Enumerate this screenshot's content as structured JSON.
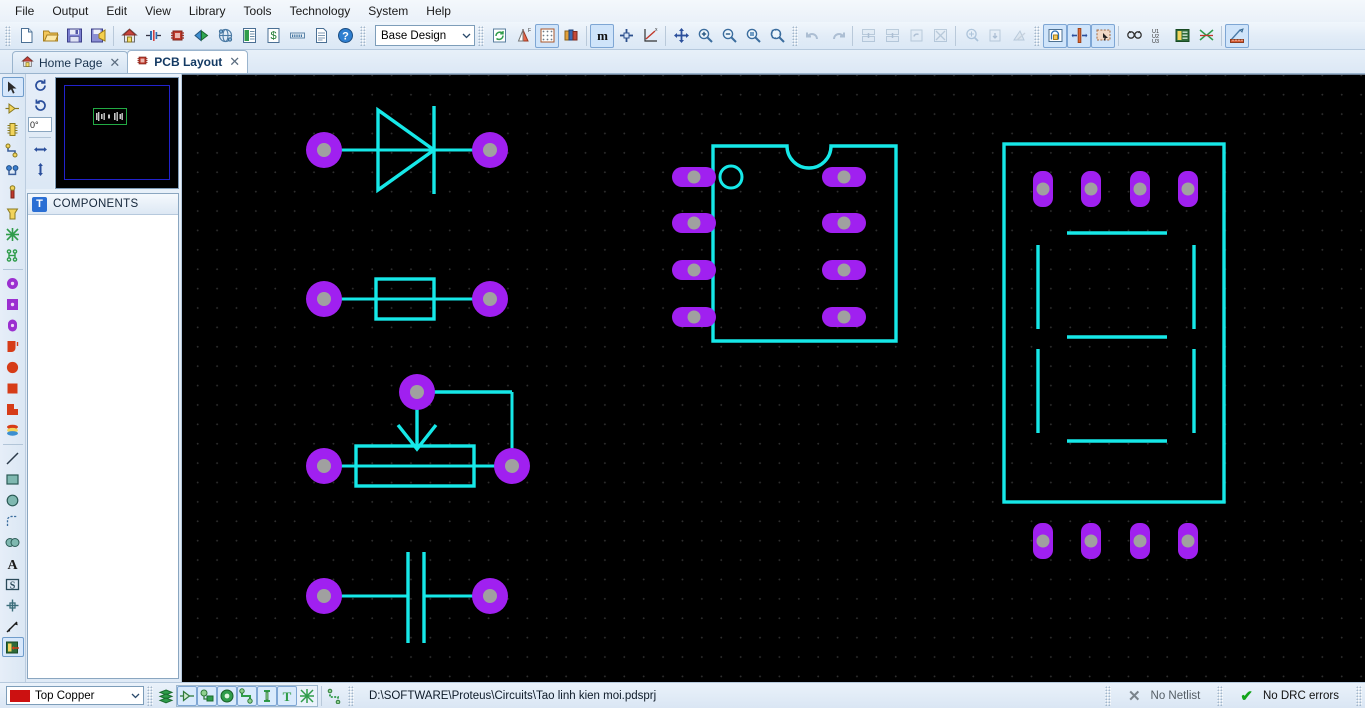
{
  "app": {
    "title": "Proteus PCB Layout"
  },
  "menu": {
    "items": [
      {
        "label": "File"
      },
      {
        "label": "Output"
      },
      {
        "label": "Edit"
      },
      {
        "label": "View"
      },
      {
        "label": "Library"
      },
      {
        "label": "Tools"
      },
      {
        "label": "Technology"
      },
      {
        "label": "System"
      },
      {
        "label": "Help"
      }
    ]
  },
  "toolbar": {
    "file_group": [
      {
        "name": "new-design-icon",
        "title": "New Design"
      },
      {
        "name": "open-design-icon",
        "title": "Open Design"
      },
      {
        "name": "save-design-icon",
        "title": "Save Design"
      },
      {
        "name": "import-export-icon",
        "title": "Import/Export"
      }
    ],
    "nav_group": [
      {
        "name": "home-page-icon",
        "title": "Home Page"
      },
      {
        "name": "schematic-capture-icon",
        "title": "Schematic Capture"
      },
      {
        "name": "pcb-layout-icon",
        "title": "PCB Layout"
      },
      {
        "name": "3d-visualizer-icon",
        "title": "3D Visualizer"
      },
      {
        "name": "design-explorer-icon",
        "title": "Design Explorer"
      },
      {
        "name": "bill-of-materials-icon",
        "title": "Bill of Materials"
      },
      {
        "name": "bom-cost-icon",
        "title": "BOM Cost"
      },
      {
        "name": "gerber-viewer-icon",
        "title": "Gerber Viewer"
      },
      {
        "name": "report-icon",
        "title": "Report"
      },
      {
        "name": "help-icon",
        "title": "Help"
      }
    ],
    "technology_value": "Base Design",
    "view_group": [
      {
        "name": "redraw-icon",
        "title": "Redraw Display"
      },
      {
        "name": "layers-icon",
        "title": "Display Layers"
      },
      {
        "name": "grid-icon",
        "title": "Toggle Grid"
      },
      {
        "name": "layer-colors-icon",
        "title": "Layer Colours"
      }
    ],
    "metric_group": [
      {
        "name": "metric-icon",
        "title": "Toggle Metric/Imperial"
      },
      {
        "name": "origin-icon",
        "title": "Set Origin"
      },
      {
        "name": "axes-icon",
        "title": "Display Origin"
      }
    ],
    "zoom_group": [
      {
        "name": "pan-icon",
        "title": "Pan"
      },
      {
        "name": "zoom-in-icon",
        "title": "Zoom In"
      },
      {
        "name": "zoom-out-icon",
        "title": "Zoom Out"
      },
      {
        "name": "zoom-all-icon",
        "title": "Zoom To View Entire Board"
      },
      {
        "name": "zoom-area-icon",
        "title": "Zoom To Area"
      }
    ],
    "edit_group": [
      {
        "name": "undo-icon",
        "title": "Undo"
      },
      {
        "name": "redo-icon",
        "title": "Redo"
      },
      {
        "name": "cut-icon",
        "title": "Cut To Clipboard"
      },
      {
        "name": "copy-icon",
        "title": "Copy To Clipboard"
      },
      {
        "name": "paste-icon",
        "title": "Paste From Clipboard"
      },
      {
        "name": "delete-icon",
        "title": "Delete Selected Objects"
      },
      {
        "name": "copy-blocks-icon",
        "title": "Copy Blocks"
      },
      {
        "name": "move-blocks-icon",
        "title": "Move Blocks"
      },
      {
        "name": "rotate-blocks-icon",
        "title": "Rotate Blocks"
      }
    ],
    "route_group": [
      {
        "name": "auto-router-icon",
        "title": "Auto Router"
      },
      {
        "name": "track-select-icon",
        "title": "Select Track"
      },
      {
        "name": "block-select-icon",
        "title": "Block Select"
      }
    ],
    "tools_group": [
      {
        "name": "search-icon",
        "title": "Search and Tag"
      },
      {
        "name": "auto-name-icon",
        "title": "Auto Name Generator"
      },
      {
        "name": "property-assignment-icon",
        "title": "Property Assignment Tool"
      },
      {
        "name": "netlist-icon",
        "title": "Netlist Compiler"
      }
    ],
    "measure_group": [
      {
        "name": "design-rule-manager-icon",
        "title": "Design Rule Manager"
      }
    ]
  },
  "tabs": [
    {
      "label": "Home Page",
      "icon": "home-icon",
      "active": false,
      "close": "✕"
    },
    {
      "label": "PCB Layout",
      "icon": "chip-icon",
      "active": true,
      "close": "✕"
    }
  ],
  "left_rail": {
    "mode_tools": [
      {
        "name": "selection-mode-icon",
        "title": "Selection Mode",
        "active": true
      },
      {
        "name": "component-mode-icon",
        "title": "Component Mode",
        "active": false
      },
      {
        "name": "package-mode-icon",
        "title": "Package Mode",
        "active": false
      },
      {
        "name": "track-mode-icon",
        "title": "Track Mode",
        "active": false
      },
      {
        "name": "via-mode-icon",
        "title": "Via Mode",
        "active": false
      },
      {
        "name": "zone-mode-icon",
        "title": "Zone Mode",
        "active": false
      },
      {
        "name": "ratsnest-mode-icon",
        "title": "Ratsnest Mode",
        "active": false
      },
      {
        "name": "connectivity-highlight-icon",
        "title": "Connectivity Highlight",
        "active": false
      },
      {
        "name": "design-rule-mode-icon",
        "title": "Design Rule Mode",
        "active": false
      }
    ],
    "pad_tools": [
      {
        "name": "round-through-hole-pad-icon",
        "title": "Round Through-hole Pad"
      },
      {
        "name": "square-through-hole-pad-icon",
        "title": "Square Through-hole Pad"
      },
      {
        "name": "dil-pad-icon",
        "title": "DIL Pad"
      },
      {
        "name": "edge-connector-pad-icon",
        "title": "Edge Connector Pad"
      },
      {
        "name": "circular-smt-pad-icon",
        "title": "Circular SMT Pad"
      },
      {
        "name": "rectangular-smt-pad-icon",
        "title": "Rectangular SMT Pad"
      },
      {
        "name": "polygonal-smt-pad-icon",
        "title": "Polygonal SMT Pad"
      },
      {
        "name": "pad-stack-icon",
        "title": "Pad Stack"
      }
    ],
    "graphics_tools": [
      {
        "name": "line-tool-icon",
        "title": "2D Graphics Line"
      },
      {
        "name": "box-tool-icon",
        "title": "2D Graphics Box"
      },
      {
        "name": "circle-tool-icon",
        "title": "2D Graphics Circle"
      },
      {
        "name": "arc-tool-icon",
        "title": "2D Graphics Arc"
      },
      {
        "name": "path-tool-icon",
        "title": "2D Graphics Closed Path"
      },
      {
        "name": "text-tool-icon",
        "title": "2D Graphics Text"
      },
      {
        "name": "symbol-tool-icon",
        "title": "2D Graphics Symbol"
      },
      {
        "name": "marker-tool-icon",
        "title": "2D Graphics Markers"
      },
      {
        "name": "dimension-tool-icon",
        "title": "Dimension Tool"
      },
      {
        "name": "layer-select-icon",
        "title": "Layer Selector"
      }
    ]
  },
  "rotation_panel": {
    "rotate_cw": {
      "name": "rotate-clockwise-icon",
      "title": "Rotate Clockwise"
    },
    "rotate_ccw": {
      "name": "rotate-anticlockwise-icon",
      "title": "Rotate Anti-clockwise"
    },
    "angle_value": "0°",
    "mirror_x": {
      "name": "mirror-horizontal-icon",
      "title": "Mirror Horizontally"
    },
    "mirror_y": {
      "name": "mirror-vertical-icon",
      "title": "Mirror Vertically"
    }
  },
  "components_panel": {
    "icon": "t-object-selector-icon",
    "header": "COMPONENTS",
    "items": []
  },
  "canvas": {
    "background": "#000000",
    "grid_color": "#2e2e2e",
    "silk_color": "#16e8e8",
    "pad_color": "#a020f0",
    "hole_color": "#a0a0a0",
    "footprints": [
      {
        "name": "diode-footprint",
        "type": "DIODE",
        "pads": 2
      },
      {
        "name": "resistor-footprint",
        "type": "RES",
        "pads": 2
      },
      {
        "name": "potentiometer-footprint",
        "type": "POT",
        "pads": 3
      },
      {
        "name": "capacitor-footprint",
        "type": "CAP",
        "pads": 2
      },
      {
        "name": "dil8-footprint",
        "type": "DIL08",
        "pads": 8
      },
      {
        "name": "seven-segment-footprint",
        "type": "7SEG",
        "pads": 8
      }
    ]
  },
  "statusbar": {
    "layer": {
      "label": "Top Copper",
      "color": "#cc1111"
    },
    "layer_tools": [
      {
        "name": "display-all-layers-icon",
        "title": "Display All Layers"
      },
      {
        "name": "toggle-components-icon",
        "title": "Toggle Component Display"
      },
      {
        "name": "toggle-pads-icon",
        "title": "Toggle Pad Display"
      },
      {
        "name": "toggle-vias-icon",
        "title": "Toggle Via Display"
      },
      {
        "name": "toggle-tracks-icon",
        "title": "Toggle Track Display"
      },
      {
        "name": "toggle-drill-icon",
        "title": "Toggle Drill Holes"
      },
      {
        "name": "toggle-text-icon",
        "title": "Toggle Text Display"
      },
      {
        "name": "toggle-ratsnest-icon",
        "title": "Toggle Ratsnest Display"
      },
      {
        "name": "toggle-connectivity-icon",
        "title": "Toggle Connectivity"
      }
    ],
    "path": "D:\\SOFTWARE\\Proteus\\Circuits\\Tao linh kien moi.pdsprj",
    "netlist": {
      "icon": "✕",
      "label": "No Netlist"
    },
    "drc": {
      "icon": "✔",
      "label": "No DRC errors"
    }
  }
}
